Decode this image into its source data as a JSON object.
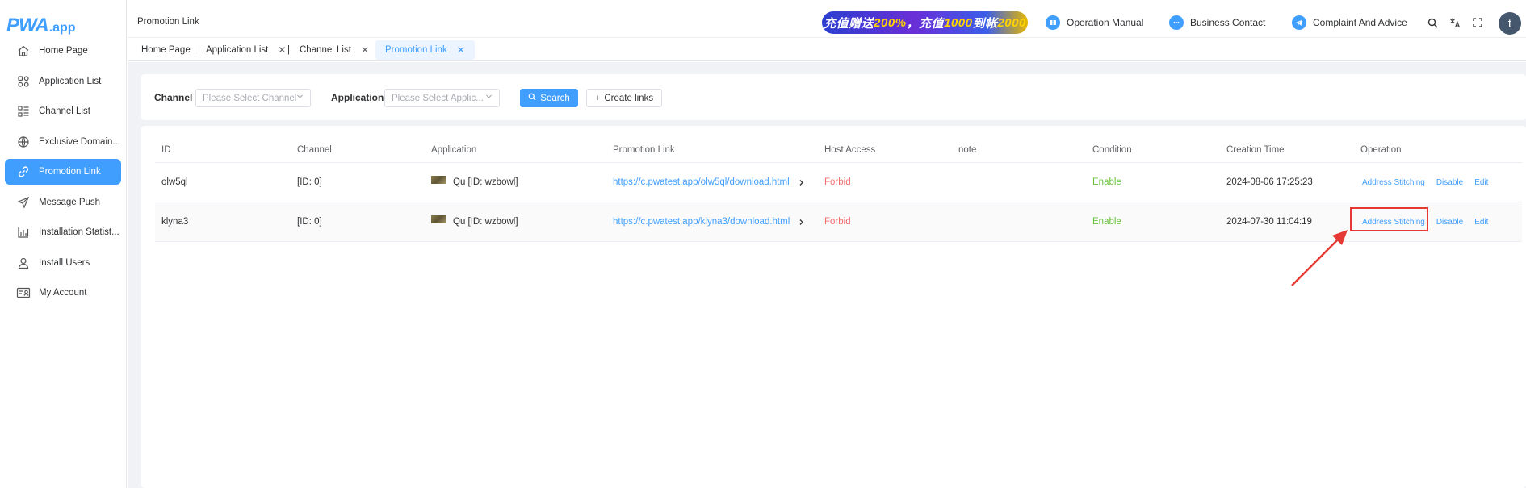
{
  "app": {
    "logo_brand": "PWA",
    "logo_tld": ".app"
  },
  "sidebar": {
    "items": [
      {
        "label": "Home Page",
        "icon": "home-icon",
        "active": false
      },
      {
        "label": "Application List",
        "icon": "apps-grid-icon",
        "active": false
      },
      {
        "label": "Channel List",
        "icon": "list-icon",
        "active": false
      },
      {
        "label": "Exclusive Domain...",
        "icon": "globe-icon",
        "active": false
      },
      {
        "label": "Promotion Link",
        "icon": "link-icon",
        "active": true
      },
      {
        "label": "Message Push",
        "icon": "send-icon",
        "active": false
      },
      {
        "label": "Installation Statist...",
        "icon": "bar-chart-icon",
        "active": false
      },
      {
        "label": "Install Users",
        "icon": "user-icon",
        "active": false
      },
      {
        "label": "My Account",
        "icon": "account-card-icon",
        "active": false
      }
    ]
  },
  "header": {
    "breadcrumb": "Promotion Link",
    "banner": {
      "part1": "充值赠送",
      "hl1": "200%",
      "part2": "，充值",
      "hl2": "1000",
      "part3": "到帐",
      "hl3": "2000"
    },
    "links": {
      "manual": "Operation Manual",
      "business": "Business Contact",
      "complaint": "Complaint And Advice"
    },
    "avatar_letter": "t"
  },
  "tabs": [
    {
      "label": "Home Page",
      "closable": false
    },
    {
      "label": "Application List",
      "closable": true
    },
    {
      "label": "Channel List",
      "closable": true
    },
    {
      "label": "Promotion Link",
      "closable": true,
      "active": true
    }
  ],
  "filters": {
    "channel_label": "Channel",
    "channel_placeholder": "Please Select Channel",
    "application_label": "Application",
    "application_placeholder": "Please Select Applic...",
    "search_button": "Search",
    "create_button": "Create links"
  },
  "table": {
    "columns": [
      "ID",
      "Channel",
      "Application",
      "Promotion Link",
      "Host Access",
      "note",
      "Condition",
      "Creation Time",
      "Operation"
    ],
    "rows": [
      {
        "id": "olw5ql",
        "channel": "[ID: 0]",
        "application": "Qu [ID: wzbowl]",
        "link": "https://c.pwatest.app/olw5ql/download.html",
        "host_access": "Forbid",
        "note": "",
        "condition": "Enable",
        "created": "2024-08-06 17:25:23",
        "ops": [
          "Address Stitching",
          "Disable",
          "Edit"
        ]
      },
      {
        "id": "klyna3",
        "channel": "[ID: 0]",
        "application": "Qu [ID: wzbowl]",
        "link": "https://c.pwatest.app/klyna3/download.html",
        "host_access": "Forbid",
        "note": "",
        "condition": "Enable",
        "created": "2024-07-30 11:04:19",
        "ops": [
          "Address Stitching",
          "Disable",
          "Edit"
        ]
      }
    ]
  },
  "colors": {
    "accent": "#409eff",
    "danger": "#f56c6c",
    "success": "#67c23a",
    "annotation": "#e53935"
  }
}
